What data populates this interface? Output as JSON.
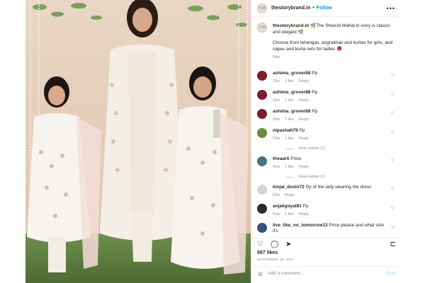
{
  "post": {
    "username": "thestorybrand.in",
    "separator": "•",
    "follow_label": "Follow",
    "more_label": "•••",
    "avatar_text": "TSB",
    "next_arrow": "›"
  },
  "caption": {
    "username": "thestorybrand.in",
    "line1": "🌿The Sheesh Mahal in ivory is classic and elegant 🌿",
    "line2": "Choose from lehengas, angrakhas and kurtas for girls, and capes and kurta sets for ladies 🧶",
    "time": "54w"
  },
  "comments": [
    {
      "username": "ashima_grover88",
      "text": "Pp",
      "time": "26w",
      "likes": "1 like",
      "reply": "Reply",
      "avatar_color": "#7a1e2a"
    },
    {
      "username": "ashima_grover88",
      "text": "Pp",
      "time": "26w",
      "likes": "1 like",
      "reply": "Reply",
      "avatar_color": "#7a1e2a"
    },
    {
      "username": "ashima_grover88",
      "text": "Pp",
      "time": "26w",
      "likes": "1 like",
      "reply": "Reply",
      "avatar_color": "#7a1e2a"
    },
    {
      "username": "nipashah76",
      "text": "Pp",
      "time": "29w",
      "likes": "1 like",
      "reply": "Reply",
      "avatar_color": "#6b8a3a",
      "view_replies": "View replies (1)"
    },
    {
      "username": "theaarti",
      "text": "Price",
      "time": "41w",
      "likes": "1 like",
      "reply": "Reply",
      "avatar_color": "#4a6f86",
      "view_replies": "View replies (1)"
    },
    {
      "username": "kinjal_doshi72",
      "text": "Pp of the lady wearing the dress",
      "time": "50w",
      "likes": "",
      "reply": "Reply",
      "avatar_color": "#d4d4d4"
    },
    {
      "username": "anjaligoyal81",
      "text": "Pp",
      "time": "51w",
      "likes": "1 like",
      "reply": "Reply",
      "avatar_color": "#2e2a2a"
    },
    {
      "username": "live_like_no_tomorrow13",
      "text": "Price please and what size it's",
      "time": "",
      "likes": "",
      "reply": "",
      "avatar_color": "#3a4f7a"
    }
  ],
  "actions": {
    "like_icon": "♡",
    "comment_icon": "◯",
    "share_icon": "➤",
    "save_icon": "⊏"
  },
  "likes_text": "897 likes",
  "date_text": "SEPTEMBER 19, 2022",
  "add_comment": {
    "emoji_icon": "☺",
    "placeholder": "Add a comment...",
    "post_label": "Post"
  },
  "colors": {
    "accent": "#0095f6",
    "post_disabled": "#b3dbff",
    "meta_gray": "#8e8e8e"
  }
}
